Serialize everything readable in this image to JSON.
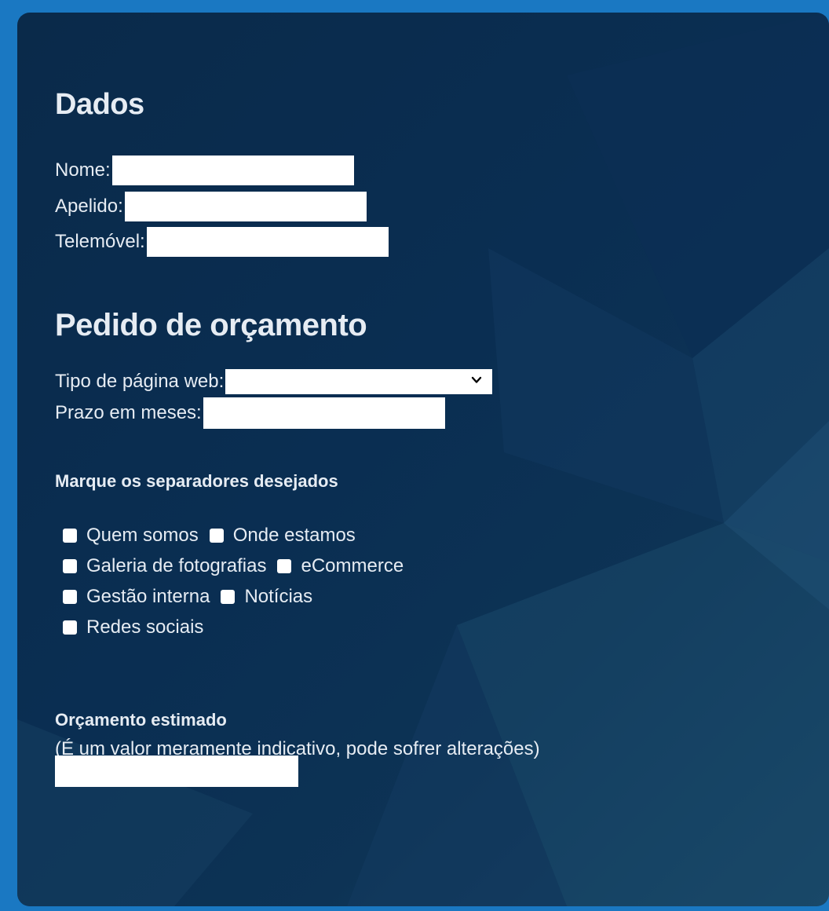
{
  "section_dados": {
    "title": "Dados",
    "fields": [
      {
        "label": "Nome:",
        "value": ""
      },
      {
        "label": "Apelido:",
        "value": ""
      },
      {
        "label": "Telemóvel:",
        "value": ""
      }
    ]
  },
  "section_pedido": {
    "title": "Pedido de orçamento",
    "tipo_label": "Tipo de página web:",
    "tipo_selected": "",
    "prazo_label": "Prazo em meses:",
    "prazo_value": ""
  },
  "separadores": {
    "title": "Marque os separadores desejados",
    "options": [
      {
        "label": "Quem somos",
        "checked": false
      },
      {
        "label": "Onde estamos",
        "checked": false
      },
      {
        "label": "Galeria de fotografias",
        "checked": false
      },
      {
        "label": "eCommerce",
        "checked": false
      },
      {
        "label": "Gestão interna",
        "checked": false
      },
      {
        "label": "Notícias",
        "checked": false
      },
      {
        "label": "Redes sociais",
        "checked": false
      }
    ]
  },
  "orcamento": {
    "title": "Orçamento estimado",
    "note": "(É um valor meramente indicativo, pode sofrer alterações)",
    "value": ""
  },
  "colors": {
    "frame": "#1a78c2",
    "panel": "#0a2e52",
    "text": "#e6ecf3",
    "input": "#ffffff"
  },
  "icons": {
    "select_arrow": "chevron-down-icon"
  }
}
